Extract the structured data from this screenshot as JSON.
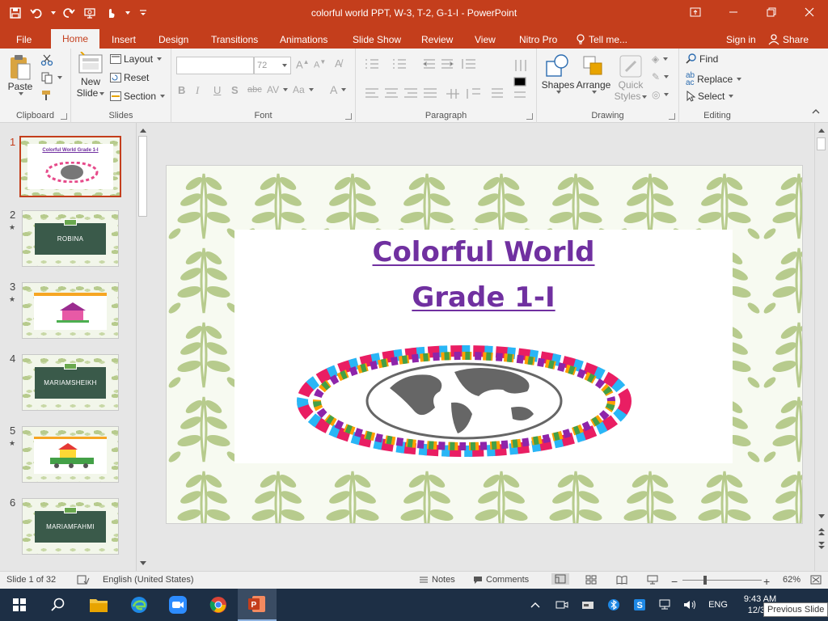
{
  "window": {
    "title": "colorful world PPT, W-3, T-2, G-1-I - PowerPoint"
  },
  "tabs": [
    {
      "label": "File"
    },
    {
      "label": "Home"
    },
    {
      "label": "Insert"
    },
    {
      "label": "Design"
    },
    {
      "label": "Transitions"
    },
    {
      "label": "Animations"
    },
    {
      "label": "Slide Show"
    },
    {
      "label": "Review"
    },
    {
      "label": "View"
    },
    {
      "label": "Nitro Pro"
    }
  ],
  "tell_me": "Tell me...",
  "sign_in": "Sign in",
  "share": "Share",
  "ribbon": {
    "clipboard": {
      "label": "Clipboard",
      "paste": "Paste"
    },
    "slides": {
      "label": "Slides",
      "new_slide_line1": "New",
      "new_slide_line2": "Slide",
      "layout": "Layout",
      "reset": "Reset",
      "section": "Section"
    },
    "font": {
      "label": "Font",
      "font_name": "",
      "font_size": "72"
    },
    "paragraph": {
      "label": "Paragraph"
    },
    "drawing": {
      "label": "Drawing",
      "shapes": "Shapes",
      "arrange": "Arrange",
      "quick_styles_line1": "Quick",
      "quick_styles_line2": "Styles"
    },
    "editing": {
      "label": "Editing",
      "find": "Find",
      "replace": "Replace",
      "select": "Select"
    }
  },
  "thumbnails": [
    {
      "num": "1",
      "star": "",
      "text": "Colorful World Grade 1-I",
      "kind": "title"
    },
    {
      "num": "2",
      "star": "★",
      "text": "ROBINA",
      "kind": "green"
    },
    {
      "num": "3",
      "star": "★",
      "text": "",
      "kind": "house"
    },
    {
      "num": "4",
      "star": "",
      "text": "MARIAMSHEIKH",
      "kind": "green"
    },
    {
      "num": "5",
      "star": "★",
      "text": "",
      "kind": "train"
    },
    {
      "num": "6",
      "star": "",
      "text": "MARIAMFAHMI",
      "kind": "green"
    }
  ],
  "slide": {
    "title_line1": "Colorful World",
    "title_line2": "Grade 1-I",
    "title_color": "#7030a0"
  },
  "status": {
    "slide_of": "Slide 1 of 32",
    "language": "English (United States)",
    "notes": "Notes",
    "comments": "Comments",
    "zoom": "62%"
  },
  "taskbar": {
    "language": "ENG",
    "time": "9:43 AM",
    "date": "12/30/",
    "tooltip": "Previous Slide"
  },
  "colors": {
    "accent": "#c43e1c",
    "taskbar": "#1d2f45",
    "leaf": "#b7cb8d"
  }
}
